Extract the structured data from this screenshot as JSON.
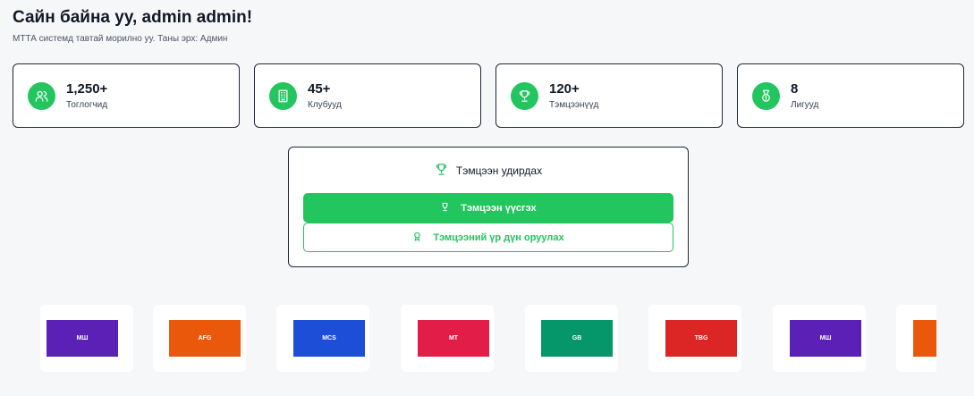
{
  "header": {
    "title": "Сайн байна уу, admin admin!",
    "subtitle": "МТТА системд тавтай морилно уу. Таны эрх: Админ"
  },
  "stats": [
    {
      "value": "1,250+",
      "label": "Тоглогчид",
      "icon": "users-icon"
    },
    {
      "value": "45+",
      "label": "Клубууд",
      "icon": "building-icon"
    },
    {
      "value": "120+",
      "label": "Тэмцээнүүд",
      "icon": "trophy-icon"
    },
    {
      "value": "8",
      "label": "Лигууд",
      "icon": "medal-icon"
    }
  ],
  "tournament_panel": {
    "title": "Тэмцээн удирдах",
    "title_icon": "trophy-icon",
    "create_label": "Тэмцээн үүсгэх",
    "results_label": "Тэмцээний үр дүн оруулах"
  },
  "colors": {
    "accent": "#22c55e",
    "text": "#111827",
    "background": "#f6f7f9"
  },
  "club_logos": [
    {
      "text": "МШ",
      "color": "#5b21b6"
    },
    {
      "text": "AFG",
      "color": "#ea580c"
    },
    {
      "text": "MCS",
      "color": "#1d4ed8"
    },
    {
      "text": "MT",
      "color": "#e11d48"
    },
    {
      "text": "GB",
      "color": "#059669"
    },
    {
      "text": "TBG",
      "color": "#dc2626"
    },
    {
      "text": "МШ",
      "color": "#5b21b6"
    },
    {
      "text": "",
      "color": "#ea580c"
    }
  ]
}
